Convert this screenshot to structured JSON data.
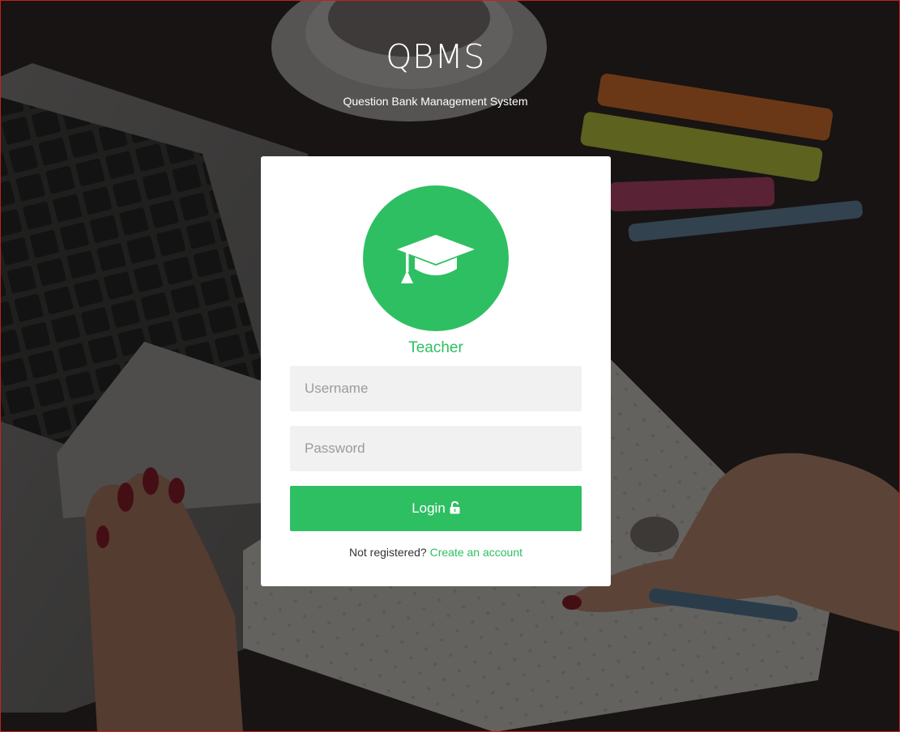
{
  "header": {
    "title": "QBMS",
    "subtitle": "Question Bank Management System"
  },
  "login_card": {
    "avatar_icon": "graduation-cap-icon",
    "role_label": "Teacher",
    "username": {
      "value": "",
      "placeholder": "Username"
    },
    "password": {
      "value": "",
      "placeholder": "Password"
    },
    "login_button": {
      "label": "Login",
      "icon": "unlock-icon"
    },
    "register": {
      "prompt": "Not registered?",
      "link_label": "Create an account"
    }
  },
  "colors": {
    "accent": "#2ebf62",
    "card_background": "#ffffff",
    "input_background": "#f1f1f1",
    "page_border": "#c62020"
  }
}
